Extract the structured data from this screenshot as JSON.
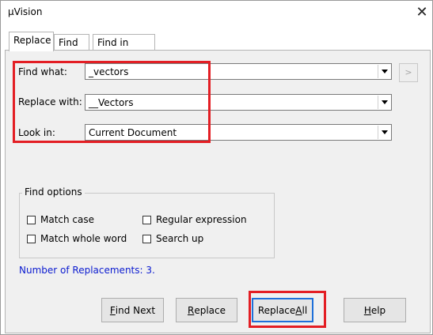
{
  "window": {
    "title": "µVision",
    "close_glyph": "✕"
  },
  "tabs": [
    {
      "label": "Replace",
      "active": true
    },
    {
      "label": "Find",
      "active": false
    },
    {
      "label": "Find in Files",
      "active": false
    }
  ],
  "fields": {
    "find_what": {
      "label": "Find what:",
      "value": "_vectors"
    },
    "replace_with": {
      "label": "Replace with:",
      "value": "__Vectors"
    },
    "look_in": {
      "label": "Look in:",
      "value": "Current Document"
    },
    "side_button_label": ">"
  },
  "find_options": {
    "title": "Find options",
    "match_case": {
      "label": "Match case",
      "checked": false
    },
    "regular_expression": {
      "label": "Regular expression",
      "checked": false
    },
    "match_whole_word": {
      "label": "Match whole word",
      "checked": false
    },
    "search_up": {
      "label": "Search up",
      "checked": false
    }
  },
  "status": "Number of Replacements: 3.",
  "buttons": {
    "find_next": {
      "pre": "",
      "ul": "F",
      "post": "ind Next"
    },
    "replace": {
      "pre": "",
      "ul": "R",
      "post": "eplace"
    },
    "replace_all": {
      "pre": "Replace ",
      "ul": "A",
      "post": "ll"
    },
    "help": {
      "pre": "",
      "ul": "H",
      "post": "elp"
    }
  },
  "colors": {
    "highlight": "#e31e24",
    "status_text": "#0b1bd0",
    "default_button_border": "#1e6fd9"
  }
}
